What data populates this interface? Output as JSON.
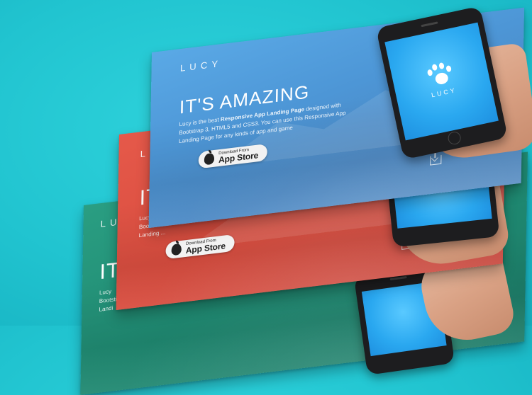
{
  "brand": "LUCY",
  "headline": "IT'S AMAZING",
  "headline_partial": "IT'S",
  "headline_partial_green": "IT",
  "description": {
    "prefix": "Lucy is the best ",
    "bold": "Responsive App Landing Page",
    "suffix": " designed with Bootstrap 3, HTML5 and CSS3. You can use this Responsive App Landing Page for any kinds of app and game"
  },
  "desc_partial_red": [
    "Lucy is ...",
    "Bootstr...",
    "Landing ..."
  ],
  "desc_partial_green": [
    "Lucy",
    "Bootsti",
    "Landi"
  ],
  "store_button": {
    "small": "Download From",
    "big": "App Store"
  },
  "phone_app_name": "LUCY",
  "colors": {
    "background": "#21c4d0",
    "blue_card": "#4d96d6",
    "red_card": "#d94c3e",
    "green_card": "#1f8a72"
  }
}
